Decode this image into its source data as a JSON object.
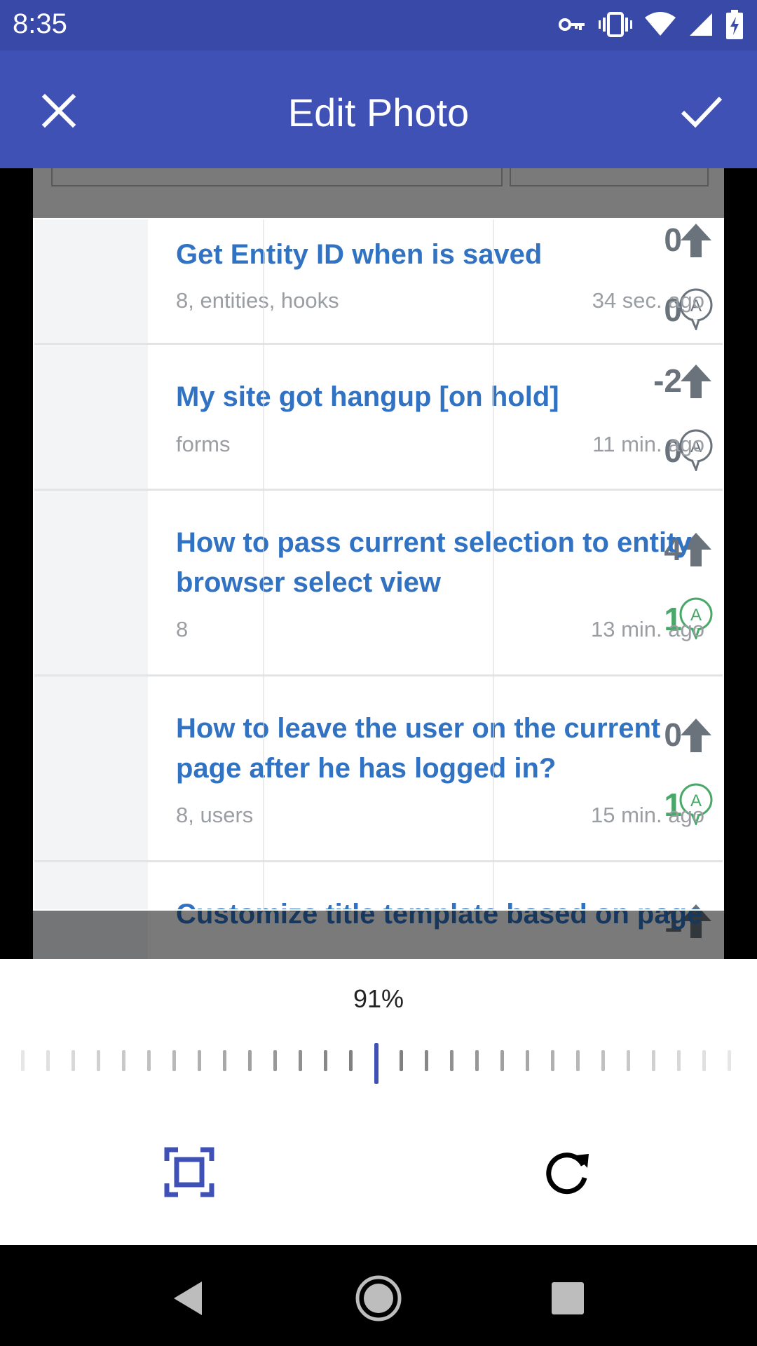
{
  "status_bar": {
    "time": "8:35",
    "icons": [
      "vpn-key-icon",
      "vibrate-icon",
      "wifi-icon",
      "signal-icon",
      "battery-charging-icon"
    ]
  },
  "app_bar": {
    "title": "Edit Photo",
    "close_icon": "close-icon",
    "confirm_icon": "check-icon"
  },
  "questions": [
    {
      "votes": "0",
      "answers": "0",
      "answered": false,
      "title": "Get Entity ID when is saved",
      "tags": "8, entities, hooks",
      "time": "34 sec. ago"
    },
    {
      "votes": "-2",
      "answers": "0",
      "answered": false,
      "title": "My site got hangup [on hold]",
      "tags": "forms",
      "time": "11 min. ago"
    },
    {
      "votes": "4",
      "answers": "1",
      "answered": true,
      "title": "How to pass current selection to entity browser select view",
      "tags": "8",
      "time": "13 min. ago"
    },
    {
      "votes": "0",
      "answers": "1",
      "answered": true,
      "title": "How to leave the user on the current page after he has logged in?",
      "tags": "8, users",
      "time": "15 min. ago"
    },
    {
      "votes": "1",
      "answers": "",
      "answered": false,
      "title": "Customize title template based on page",
      "tags": "",
      "time": ""
    }
  ],
  "zoom": {
    "value_label": "91%",
    "value": 0.91
  },
  "tools": {
    "crop": "crop-free-icon",
    "rotate": "rotate-icon"
  },
  "nav_bar": {
    "back": "back-icon",
    "home": "home-icon",
    "recents": "recents-icon"
  },
  "colors": {
    "accent": "#3f51b5",
    "status_bar": "#3949a8",
    "title_blue": "#3173c2",
    "answered_green": "#48a868"
  }
}
